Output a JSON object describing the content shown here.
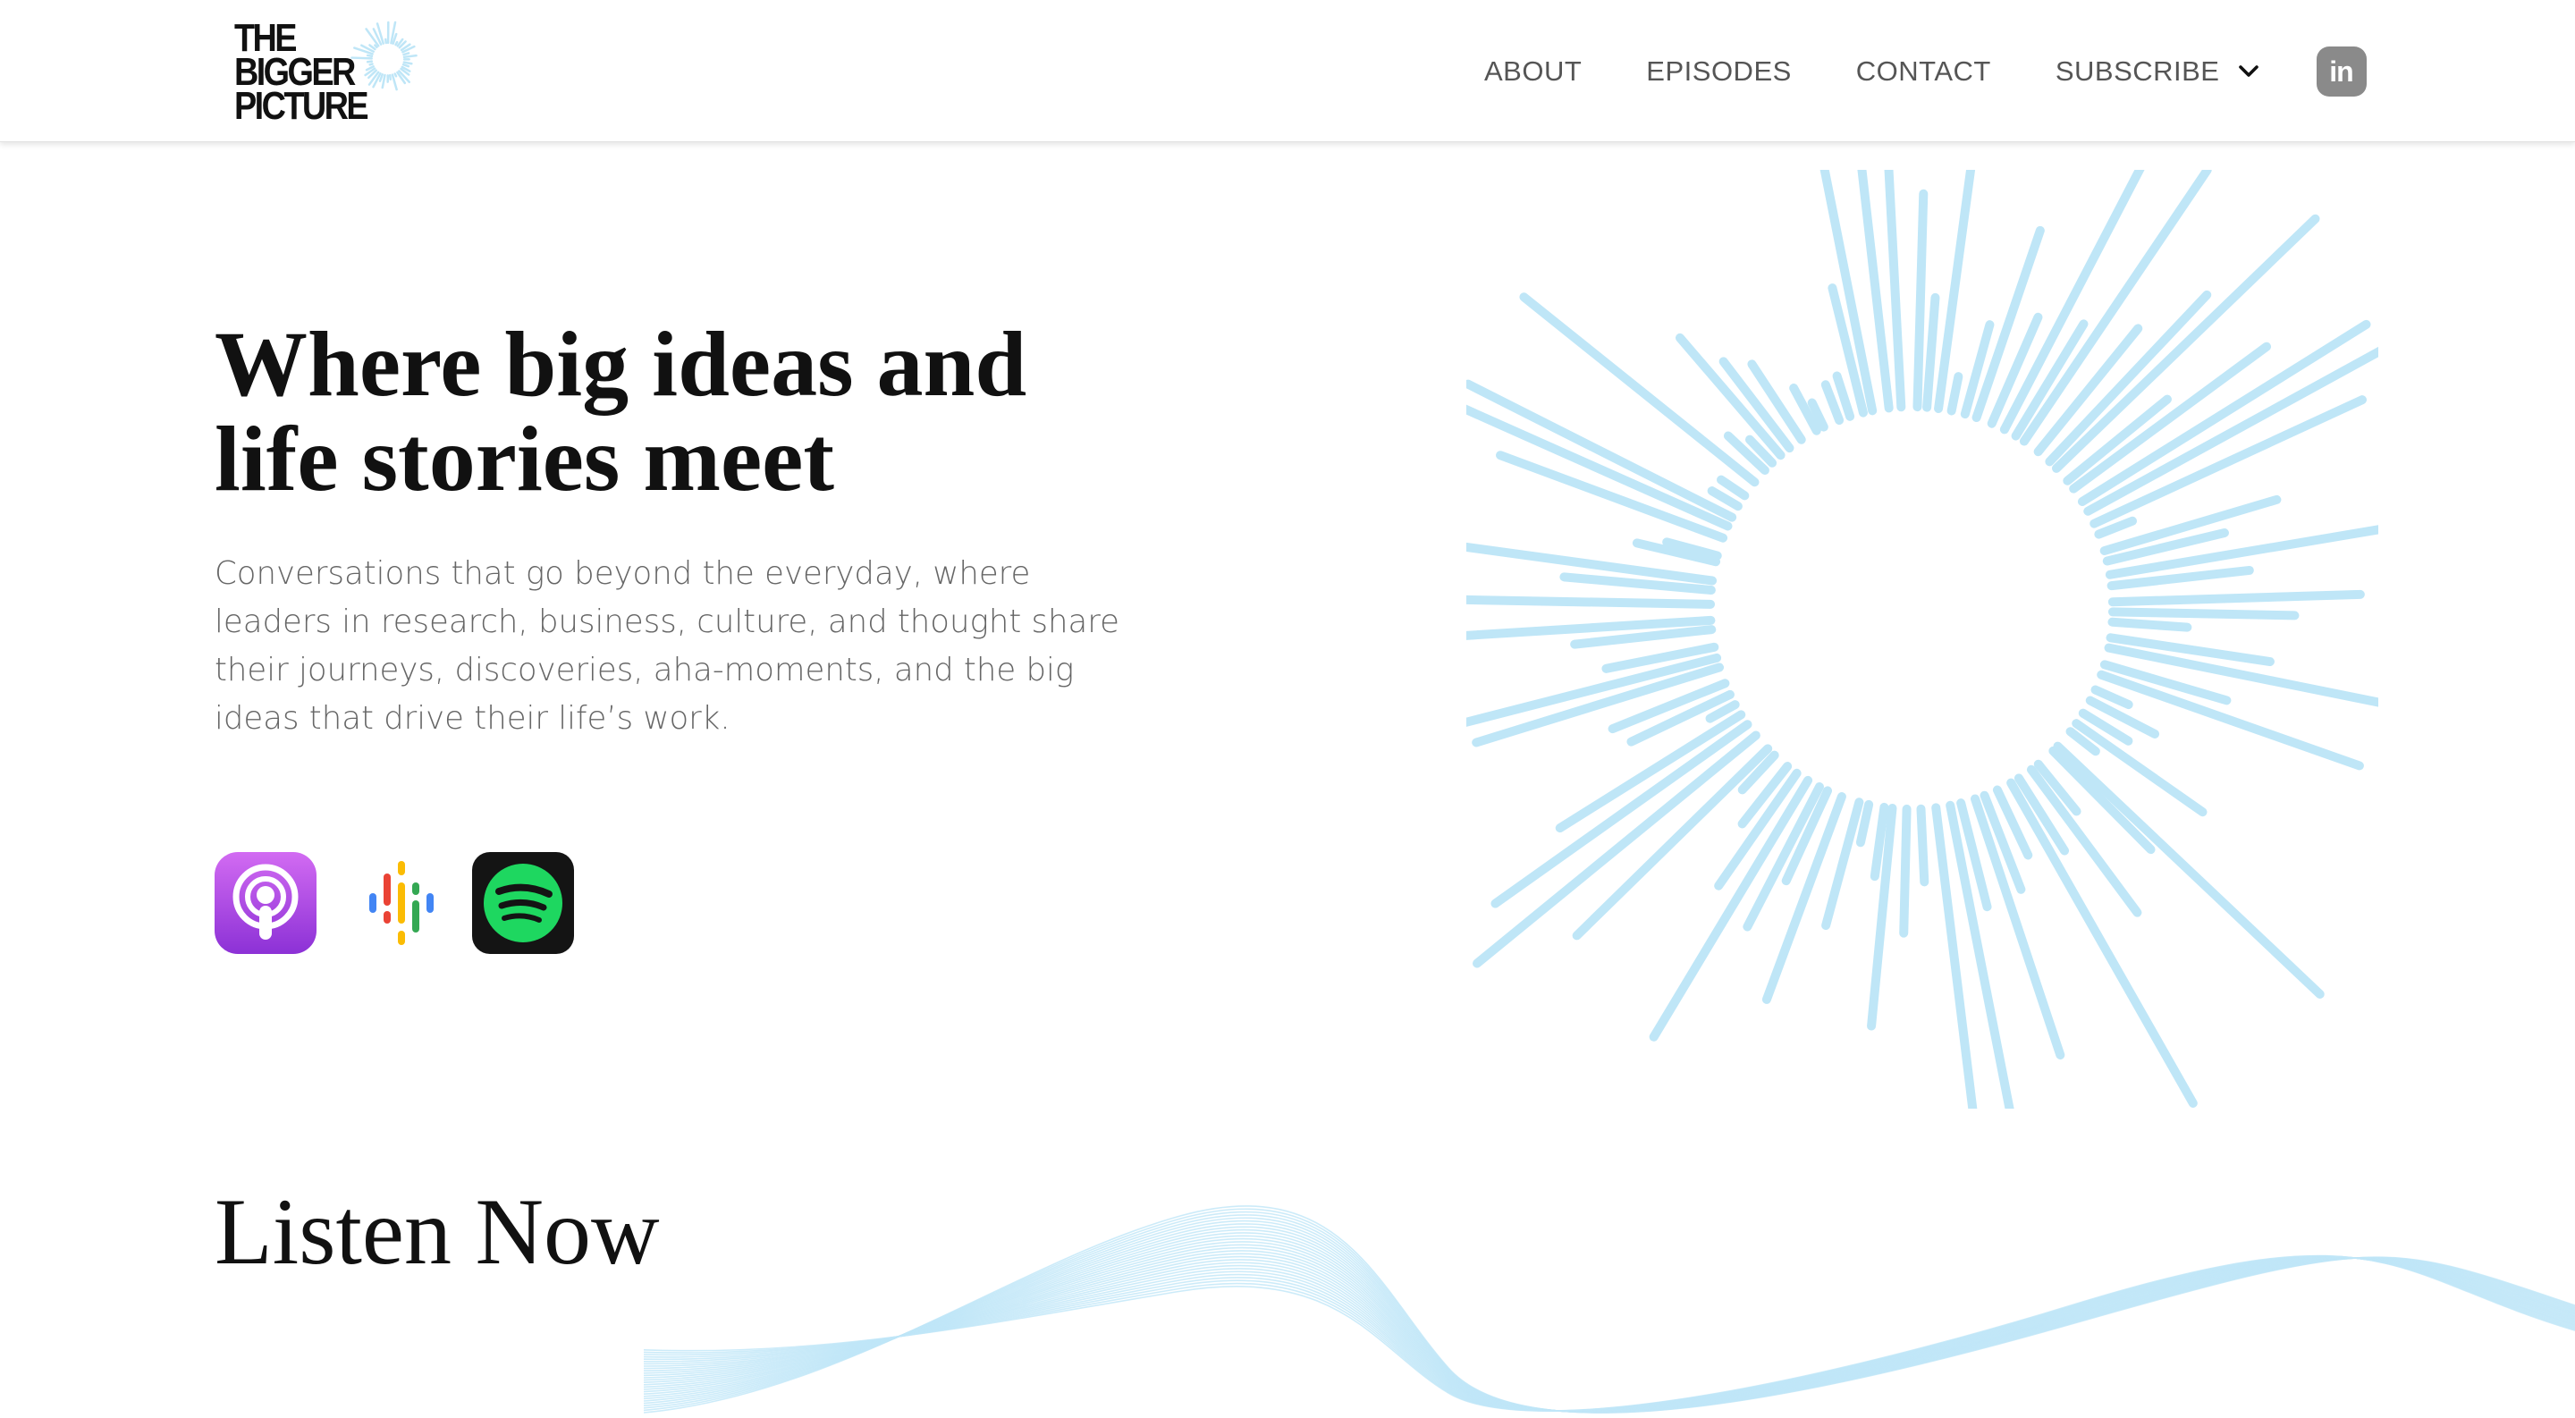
{
  "brand": {
    "logo_lines": [
      "THE",
      "BIGGER",
      "PICTURE"
    ],
    "accent_color": "#bfe6f7"
  },
  "nav": {
    "items": [
      {
        "label": "ABOUT"
      },
      {
        "label": "EPISODES"
      },
      {
        "label": "CONTACT"
      },
      {
        "label": "SUBSCRIBE",
        "has_dropdown": true
      }
    ],
    "social_icon": "linkedin-icon",
    "social_label": "in"
  },
  "hero": {
    "headline_lines": [
      "Where big ideas and",
      "life stories meet"
    ],
    "description": "Conversations that go beyond the everyday, where leaders in research, business, culture, and thought share their journeys, discoveries, aha-moments, and the big ideas that drive their life’s work.",
    "platforms": [
      {
        "icon": "apple-podcasts-icon"
      },
      {
        "icon": "google-podcasts-icon"
      },
      {
        "icon": "spotify-icon"
      }
    ]
  },
  "listen": {
    "title": "Listen Now"
  }
}
